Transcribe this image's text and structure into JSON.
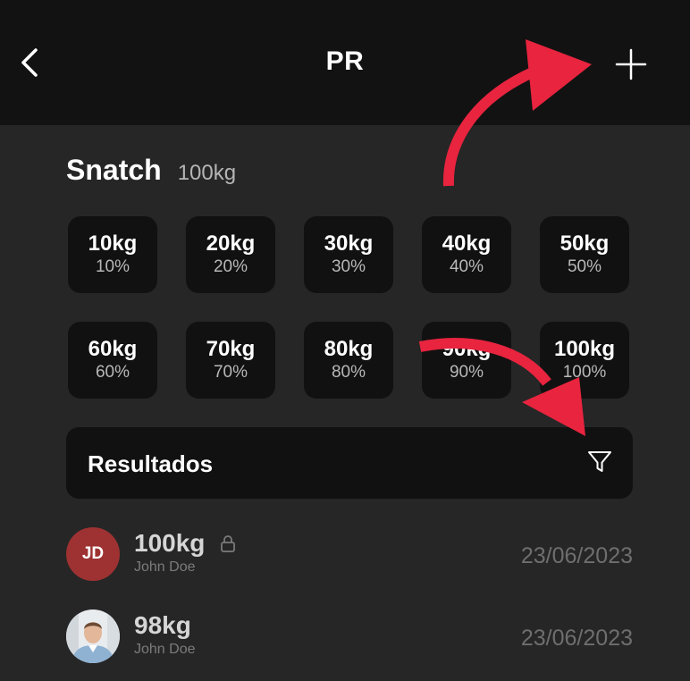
{
  "header": {
    "title": "PR"
  },
  "lift": {
    "name": "Snatch",
    "pr": "100kg"
  },
  "percentages": [
    {
      "weight": "10kg",
      "percent": "10%"
    },
    {
      "weight": "20kg",
      "percent": "20%"
    },
    {
      "weight": "30kg",
      "percent": "30%"
    },
    {
      "weight": "40kg",
      "percent": "40%"
    },
    {
      "weight": "50kg",
      "percent": "50%"
    },
    {
      "weight": "60kg",
      "percent": "60%"
    },
    {
      "weight": "70kg",
      "percent": "70%"
    },
    {
      "weight": "80kg",
      "percent": "80%"
    },
    {
      "weight": "90kg",
      "percent": "90%"
    },
    {
      "weight": "100kg",
      "percent": "100%"
    }
  ],
  "results": {
    "title": "Resultados",
    "items": [
      {
        "initials": "JD",
        "weight": "100kg",
        "user": "John Doe",
        "date": "23/06/2023",
        "locked": true,
        "avatar": "initials"
      },
      {
        "initials": "",
        "weight": "98kg",
        "user": "John Doe",
        "date": "23/06/2023",
        "locked": false,
        "avatar": "photo"
      }
    ]
  },
  "icons": {
    "back": "chevron-left-icon",
    "add": "plus-icon",
    "filter": "filter-icon",
    "lock": "lock-icon"
  },
  "colors": {
    "header_bg": "#121212",
    "page_bg": "#262626",
    "tile_bg": "#111111",
    "avatar_bg": "#9e3232",
    "annotation_arrow": "#e8243f"
  }
}
